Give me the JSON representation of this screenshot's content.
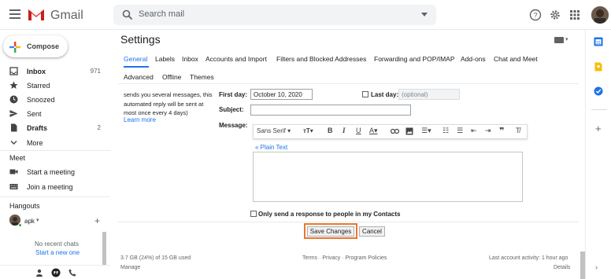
{
  "header": {
    "app_name": "Gmail",
    "search_placeholder": "Search mail"
  },
  "sidebar": {
    "compose_label": "Compose",
    "items": [
      {
        "label": "Inbox",
        "count": "971",
        "icon": "inbox-icon",
        "bold": true
      },
      {
        "label": "Starred",
        "count": "",
        "icon": "star-icon"
      },
      {
        "label": "Snoozed",
        "count": "",
        "icon": "clock-icon"
      },
      {
        "label": "Sent",
        "count": "",
        "icon": "send-icon"
      },
      {
        "label": "Drafts",
        "count": "2",
        "icon": "draft-icon",
        "bold": true
      },
      {
        "label": "More",
        "count": "",
        "icon": "chevron-down-icon"
      }
    ],
    "meet": {
      "title": "Meet",
      "start": "Start a meeting",
      "join": "Join a meeting"
    },
    "hangouts": {
      "title": "Hangouts",
      "user": "apk",
      "no_recent": "No recent chats",
      "start_new": "Start a new one"
    }
  },
  "settings": {
    "title": "Settings",
    "tabs_row1": [
      "General",
      "Labels",
      "Inbox",
      "Accounts and Import",
      "Filters and Blocked Addresses",
      "Forwarding and POP/IMAP",
      "Add-ons",
      "Chat and Meet"
    ],
    "tabs_row2": [
      "Advanced",
      "Offline",
      "Themes"
    ],
    "desc_lines": [
      "sends you several messages, this",
      "automated reply will be sent at",
      "most once every 4 days)"
    ],
    "learn_more": "Learn more",
    "first_day_label": "First day:",
    "first_day_value": "October 10, 2020",
    "last_day_label": "Last day:",
    "last_day_placeholder": "(optional)",
    "subject_label": "Subject:",
    "message_label": "Message:",
    "font_name": "Sans Serif",
    "plain_text_link": "« Plain Text",
    "contacts_only_label": "Only send a response to people in my Contacts",
    "save_label": "Save Changes",
    "cancel_label": "Cancel"
  },
  "footer": {
    "storage": "3.7 GB (24%) of 15 GB used",
    "manage": "Manage",
    "terms": "Terms",
    "dot1": "·",
    "privacy": "Privacy",
    "dot2": "·",
    "policies": "Program Policies",
    "last_activity": "Last account activity: 1 hour ago",
    "details": "Details"
  },
  "colors": {
    "accent": "#1a73e8",
    "highlight": "#e8772e"
  }
}
